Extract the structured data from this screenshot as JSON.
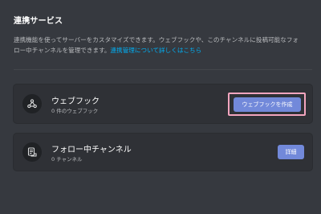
{
  "section": {
    "title": "連携サービス",
    "description_line1": "連携機能を使ってサーバーをカスタマイズできます。ウェブフックや、このチャンネルに投稿可能なフォ",
    "description_line2_prefix": "ロー中チャンネルを管理できます。",
    "description_link": "連携管理について詳しくはこちら"
  },
  "webhook_card": {
    "icon": "webhook-icon",
    "title": "ウェブフック",
    "subtitle": "0 件のウェブフック",
    "button_label": "ウェブフックを作成"
  },
  "follow_card": {
    "icon": "follow-channel-icon",
    "title": "フォロー中チャンネル",
    "subtitle": "0 チャンネル",
    "button_label": "詳細"
  },
  "colors": {
    "accent": "#7289da",
    "link": "#00aff4",
    "highlight": "#f3a5bf",
    "background": "#36393f",
    "card": "#2f3136"
  }
}
